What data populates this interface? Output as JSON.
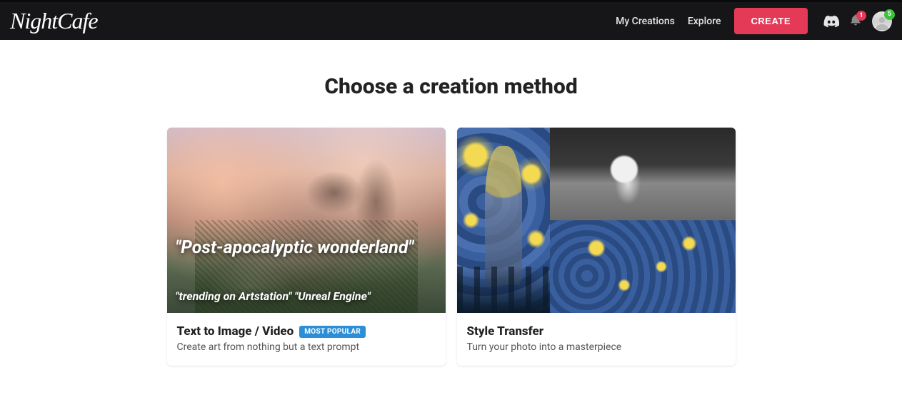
{
  "header": {
    "logo": "NightCafe",
    "nav": {
      "my_creations": "My Creations",
      "explore": "Explore",
      "create": "CREATE"
    },
    "notifications_badge": "1",
    "credits_badge": "5"
  },
  "page": {
    "title": "Choose a creation method"
  },
  "cards": {
    "text_to_image": {
      "title": "Text to Image / Video",
      "badge": "MOST POPULAR",
      "subtitle": "Create art from nothing but a text prompt",
      "overlay_line1": "\"Post-apocalyptic wonderland\"",
      "overlay_line2": "\"trending on Artstation\" \"Unreal Engine\""
    },
    "style_transfer": {
      "title": "Style Transfer",
      "subtitle": "Turn your photo into a masterpiece"
    }
  }
}
